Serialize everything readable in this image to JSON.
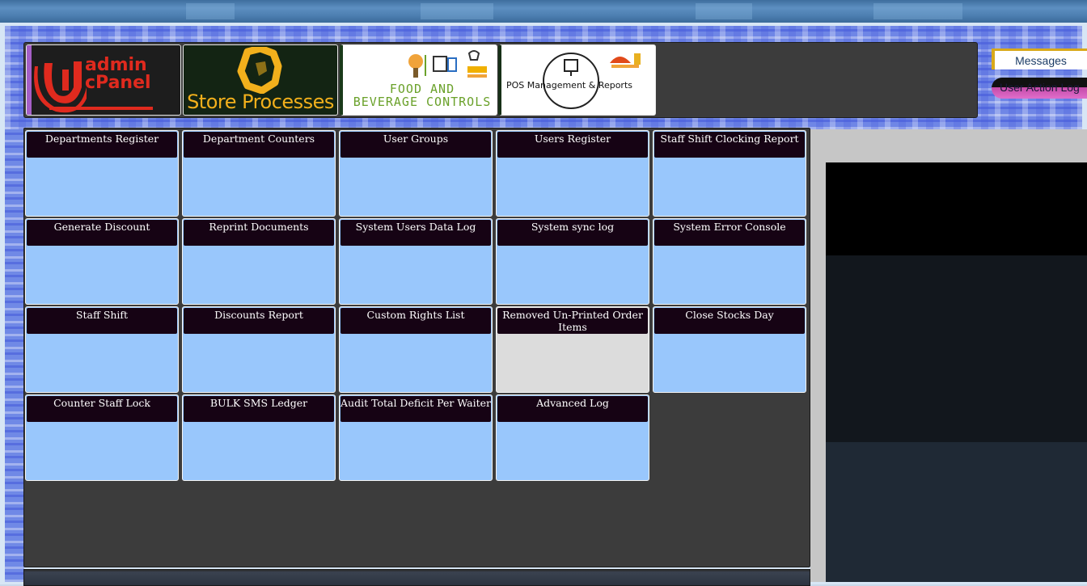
{
  "header": {
    "messages_label": "Messages",
    "action_log_label": "User Action Log"
  },
  "logos": [
    {
      "line1": "admin",
      "line2": "cPanel"
    },
    {
      "text": "Store Processes"
    },
    {
      "line1": "FOOD AND",
      "line2": "BEVERAGE CONTROLS"
    },
    {
      "text": "POS Management & Reports"
    }
  ],
  "tiles": [
    "Departments Register",
    "Department Counters",
    "User Groups",
    "Users Register",
    "Staff Shift Clocking Report",
    "Generate Discount",
    "Reprint Documents",
    "System Users Data Log",
    "System sync log",
    "System Error Console",
    "Staff Shift",
    "Discounts Report",
    "Custom Rights List",
    "Removed Un-Printed Order Items",
    "Close Stocks Day",
    "Counter Staff Lock",
    "BULK SMS Ledger",
    "Audit Total Deficit Per Waiter",
    "Advanced Log"
  ],
  "colors": {
    "tile_bg": "#99c7fc",
    "tile_header_bg": "#160314",
    "panel_bg": "#3c3c3c",
    "admin_red": "#e02a1e",
    "store_gold": "#f2b01c",
    "fnb_green": "#6aa12a"
  }
}
